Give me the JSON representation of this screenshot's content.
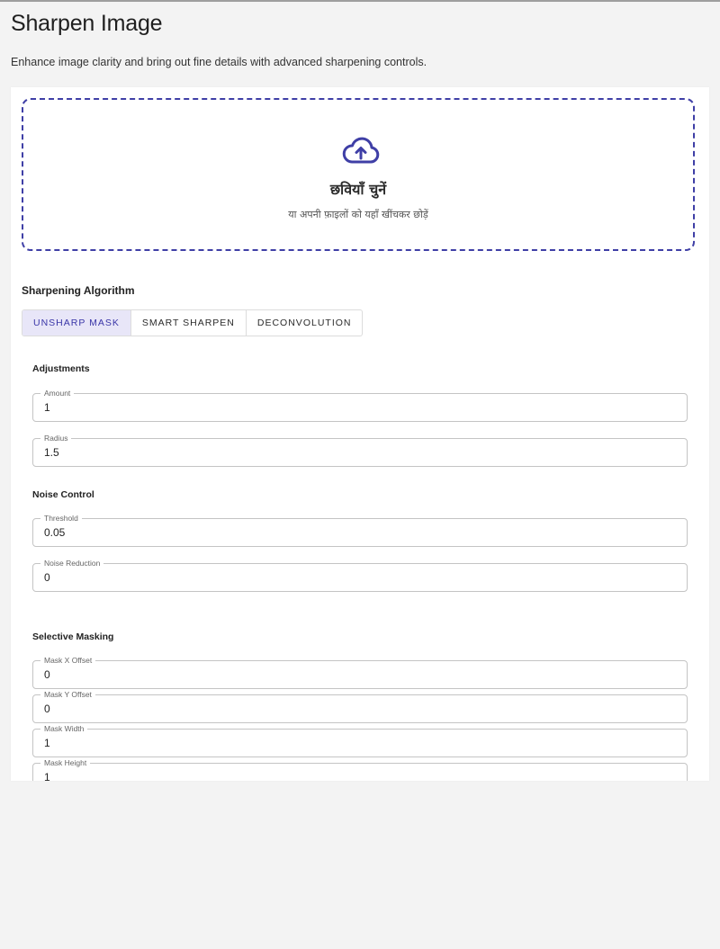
{
  "page": {
    "title": "Sharpen Image",
    "subtitle": "Enhance image clarity and bring out fine details with advanced sharpening controls."
  },
  "dropzone": {
    "icon": "cloud-upload-icon",
    "title": "छवियाँ चुनें",
    "subtitle": "या अपनी फ़ाइलों को यहाँ खींचकर छोड़ें"
  },
  "algorithm": {
    "label": "Sharpening Algorithm",
    "tabs": [
      {
        "label": "UNSHARP MASK",
        "active": true
      },
      {
        "label": "SMART SHARPEN",
        "active": false
      },
      {
        "label": "DECONVOLUTION",
        "active": false
      }
    ]
  },
  "adjustments": {
    "label": "Adjustments",
    "fields": [
      {
        "label": "Amount",
        "value": "1"
      },
      {
        "label": "Radius",
        "value": "1.5"
      }
    ]
  },
  "noise_control": {
    "label": "Noise Control",
    "fields": [
      {
        "label": "Threshold",
        "value": "0.05"
      },
      {
        "label": "Noise Reduction",
        "value": "0"
      }
    ]
  },
  "selective_masking": {
    "label": "Selective Masking",
    "fields": [
      {
        "label": "Mask X Offset",
        "value": "0"
      },
      {
        "label": "Mask Y Offset",
        "value": "0"
      },
      {
        "label": "Mask Width",
        "value": "1"
      },
      {
        "label": "Mask Height",
        "value": "1"
      }
    ]
  },
  "colors": {
    "accent": "#3f3fa6",
    "active_tab_bg": "#e8e6f8",
    "page_bg": "#f3f3f3"
  }
}
